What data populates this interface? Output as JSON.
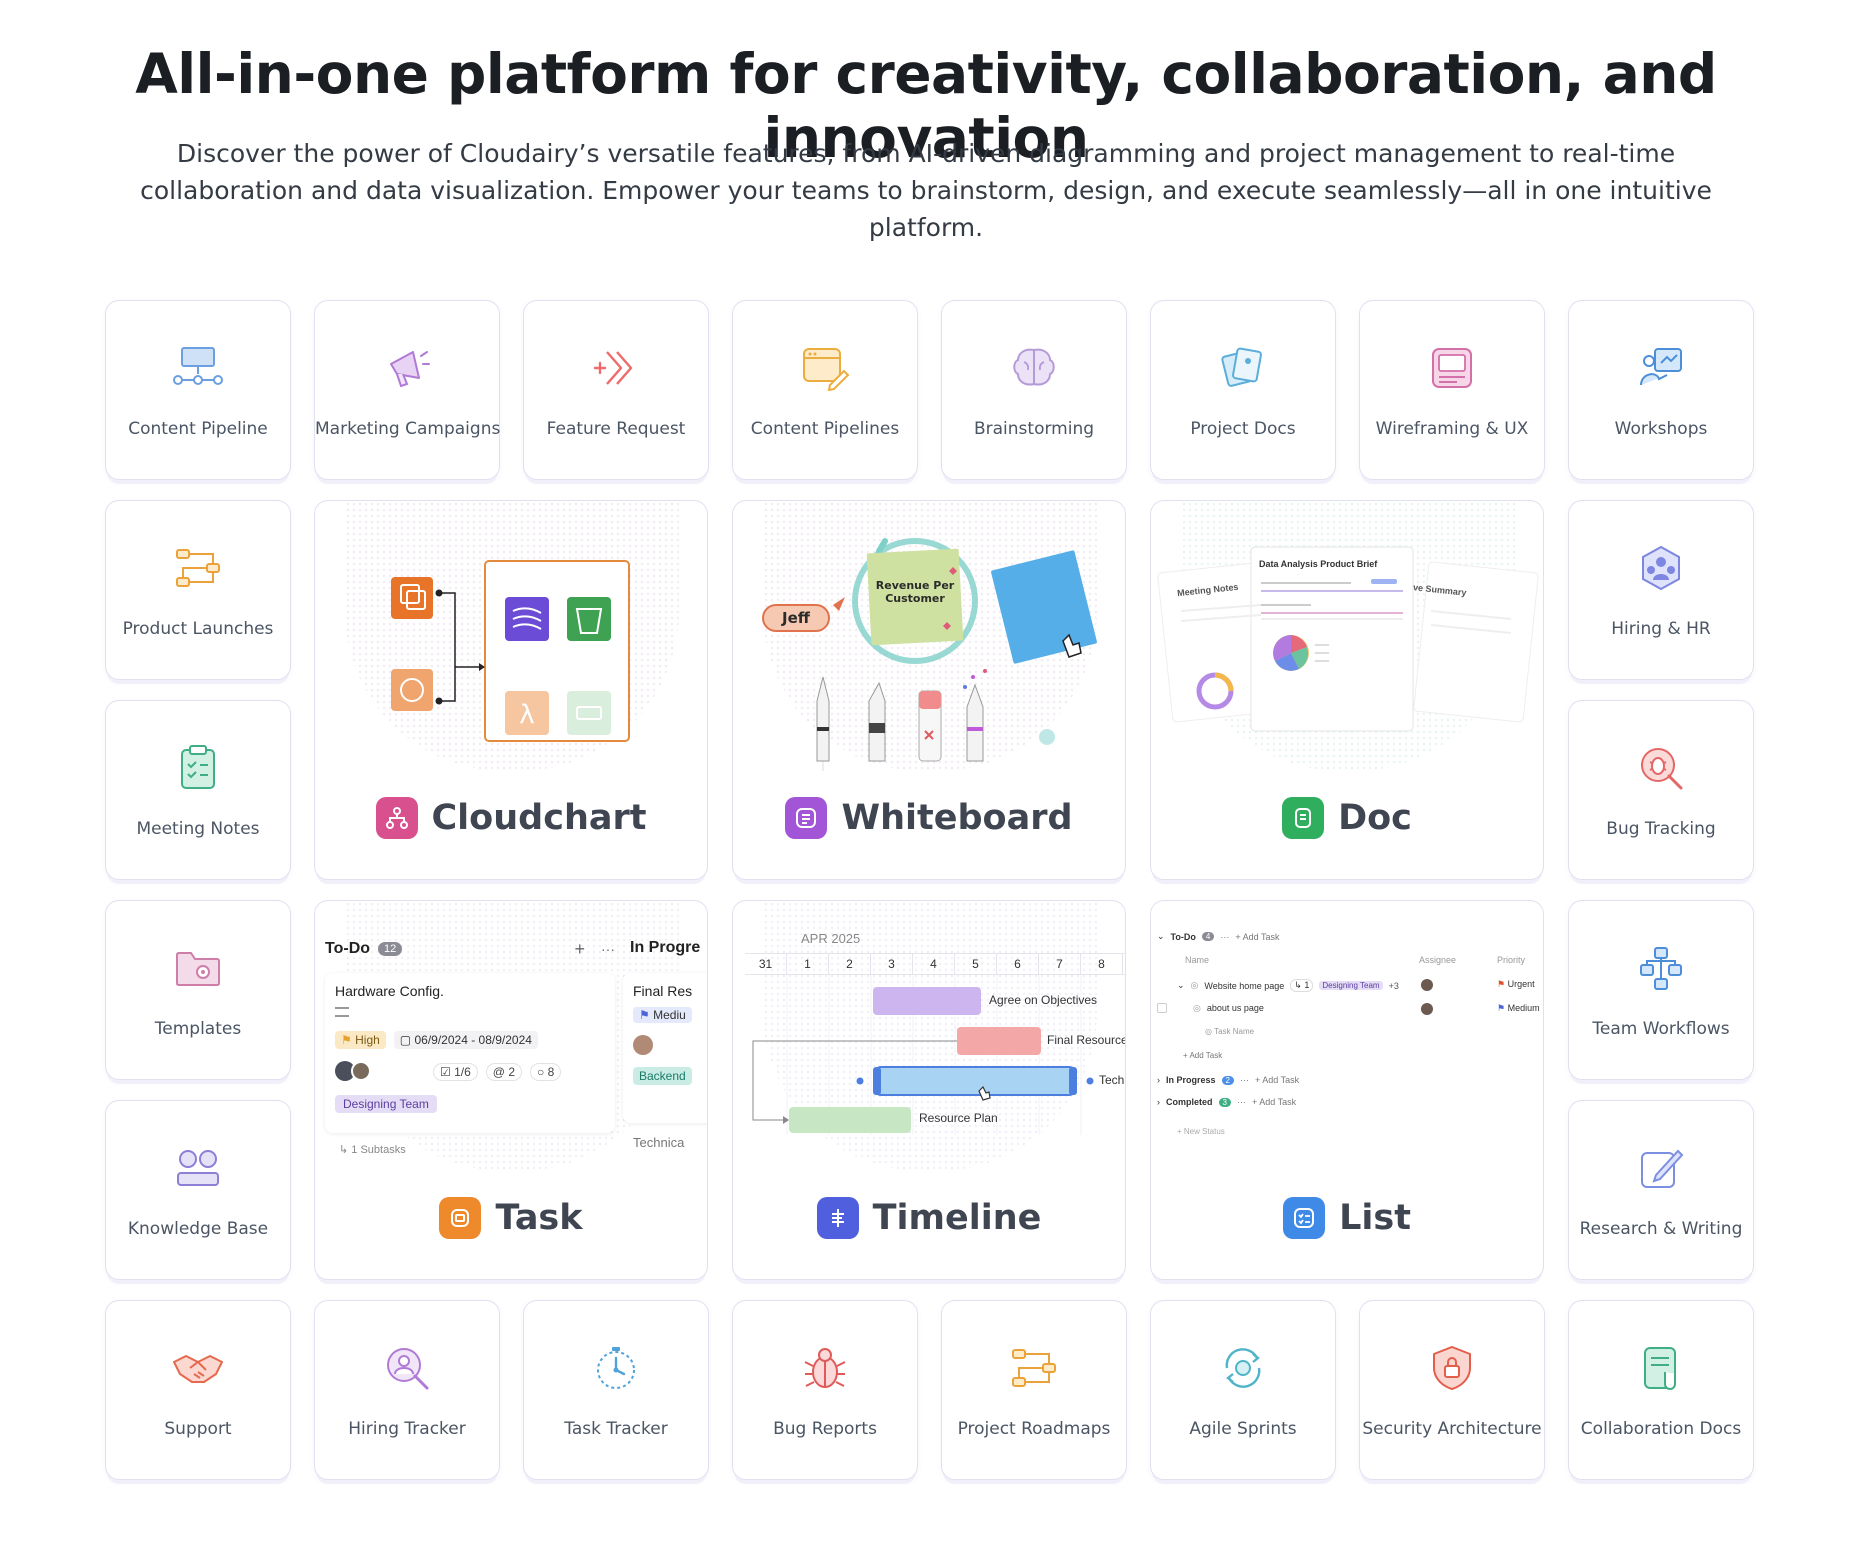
{
  "hero": {
    "title": "All-in-one platform for creativity, collaboration, and innovation",
    "subtitle": "Discover the power of Cloudairy’s versatile features, from AI-driven diagramming and project management to real-time collaboration and data visualization. Empower your teams to brainstorm, design, and execute seamlessly—all in one intuitive platform."
  },
  "tiles": {
    "content_pipeline": "Content Pipeline",
    "marketing_campaigns": "Marketing Campaigns",
    "feature_request": "Feature Request",
    "content_pipelines": "Content Pipelines",
    "brainstorming": "Brainstorming",
    "project_docs": "Project Docs",
    "wireframing_ux": "Wireframing & UX",
    "workshops": "Workshops",
    "product_launches": "Product Launches",
    "hiring_hr": "Hiring & HR",
    "meeting_notes": "Meeting Notes",
    "bug_tracking": "Bug Tracking",
    "templates": "Templates",
    "team_workflows": "Team Workflows",
    "knowledge_base": "Knowledge Base",
    "research_writing": "Research & Writing",
    "support": "Support",
    "hiring_tracker": "Hiring Tracker",
    "task_tracker": "Task Tracker",
    "bug_reports": "Bug Reports",
    "project_roadmaps": "Project Roadmaps",
    "agile_sprints": "Agile Sprints",
    "security_architecture": "Security Architecture",
    "collaboration_docs": "Collaboration Docs"
  },
  "features": {
    "cloudchart": {
      "title": "Cloudchart",
      "color": "#d9508f"
    },
    "whiteboard": {
      "title": "Whiteboard",
      "color": "#a255d6",
      "user_tag": "Jeff",
      "sticky_note": "Revenue Per Customer"
    },
    "doc": {
      "title": "Doc",
      "color": "#2fae5e",
      "doc_title": "Data Analysis Product Brief",
      "left_card": "Meeting Notes",
      "right_card": "ve Summary"
    },
    "task": {
      "title": "Task",
      "color": "#ef8a2c",
      "col1": "To-Do",
      "col1_count": "12",
      "col2": "In Progre",
      "card_title": "Hardware Config.",
      "priority": "High",
      "dates": "06/9/2024 - 08/9/2024",
      "checks": "1/6",
      "attachments": "2",
      "comments": "8",
      "team": "Designing Team",
      "subtasks": "1 Subtasks",
      "card2_title": "Final Res",
      "card2_priority": "Mediu",
      "card2_tag": "Backend",
      "card3": "Technica"
    },
    "timeline": {
      "title": "Timeline",
      "color": "#4f5fdd",
      "month": "APR 2025",
      "days": [
        "31",
        "1",
        "2",
        "3",
        "4",
        "5",
        "6",
        "7",
        "8"
      ],
      "bars": [
        "Agree on Objectives",
        "Final Resource",
        "Tech",
        "Resource Plan"
      ]
    },
    "list": {
      "title": "List",
      "color": "#3f8ae6",
      "group1": "To-Do",
      "group1_count": "4",
      "add_task": "+ Add Task",
      "col_name": "Name",
      "col_assignee": "Assignee",
      "col_priority": "Priority",
      "row1": "Website home page",
      "row1_sub": "1",
      "row1_tag": "Designing Team",
      "row1_more": "+3",
      "row1_priority": "Urgent",
      "row2": "about us page",
      "row2_priority": "Medium",
      "row3": "Task Name",
      "group2": "In Progress",
      "group2_count": "2",
      "group3": "Completed",
      "group3_count": "3",
      "new_status": "+ New Status"
    }
  }
}
